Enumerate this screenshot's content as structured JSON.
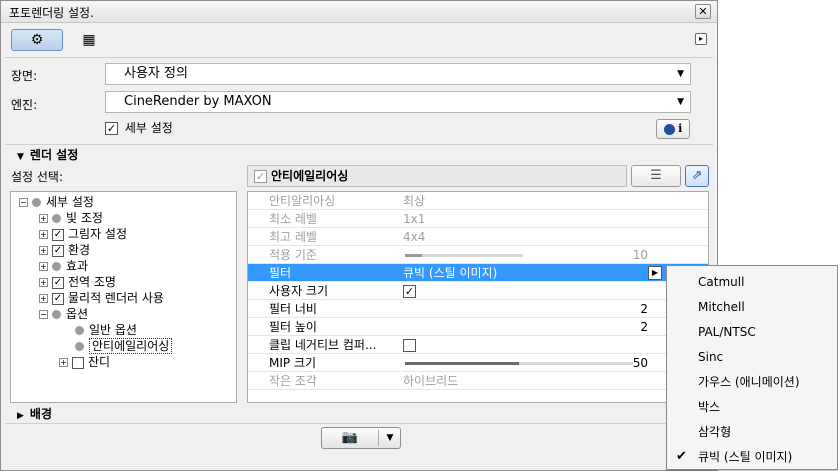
{
  "window": {
    "title": "포토렌더링 설정.",
    "close_glyph": "✕"
  },
  "toolbar": {
    "tab_gear_icon": "⚙",
    "tab_view_icon": "▦",
    "more_arrow": "▸"
  },
  "scene": {
    "label": "장면:",
    "value": "사용자 정의"
  },
  "engine": {
    "label": "엔진:",
    "value": "CineRender by MAXON",
    "detail_checkbox_label": "세부 설정",
    "detail_checked": true,
    "info_icon": "i"
  },
  "render_settings": {
    "header": "렌더 설정",
    "select_label": "설정 선택:"
  },
  "tree": {
    "root": "세부 설정",
    "items": [
      {
        "label": "빛 조정",
        "checked": null
      },
      {
        "label": "그림자 설정",
        "checked": true
      },
      {
        "label": "환경",
        "checked": true
      },
      {
        "label": "효과",
        "checked": null
      },
      {
        "label": "전역 조명",
        "checked": true
      },
      {
        "label": "물리적 렌더러 사용",
        "checked": true
      },
      {
        "label": "옵션",
        "checked": null
      }
    ],
    "options_children": [
      "일반 옵션",
      "안티에일리어싱"
    ],
    "last_item": "잔디"
  },
  "panel": {
    "header": "안티에일리어싱",
    "rows": [
      {
        "key": "안티알리아싱",
        "value": "최상",
        "dim": true
      },
      {
        "key": "최소 레벨",
        "value": "1x1",
        "dim": true
      },
      {
        "key": "최고 레벨",
        "value": "4x4",
        "dim": true
      },
      {
        "key": "적용 기준",
        "value": "10",
        "dim": true,
        "slider": 0.14
      },
      {
        "key": "필터",
        "value": "큐빅 (스틸 이미지)",
        "selected": true
      },
      {
        "key": "사용자 크기",
        "checkbox": true
      },
      {
        "key": "필터 너비",
        "value": "2"
      },
      {
        "key": "필터 높이",
        "value": "2"
      },
      {
        "key": "클립 네거티브 컴퍼...",
        "checkbox": false
      },
      {
        "key": "MIP 크기",
        "value": "50",
        "slider": 0.5
      },
      {
        "key": "작은 조각",
        "value": "하이브리드",
        "dim": true
      }
    ]
  },
  "filter_menu": {
    "options": [
      "Catmull",
      "Mitchell",
      "PAL/NTSC",
      "Sinc",
      "가우스 (애니메이션)",
      "박스",
      "삼각형",
      "큐빅 (스틸 이미지)"
    ],
    "selected_index": 7
  },
  "background_section": {
    "header": "배경"
  },
  "bottom": {
    "camera_icon": "📷",
    "caret": "▼"
  }
}
